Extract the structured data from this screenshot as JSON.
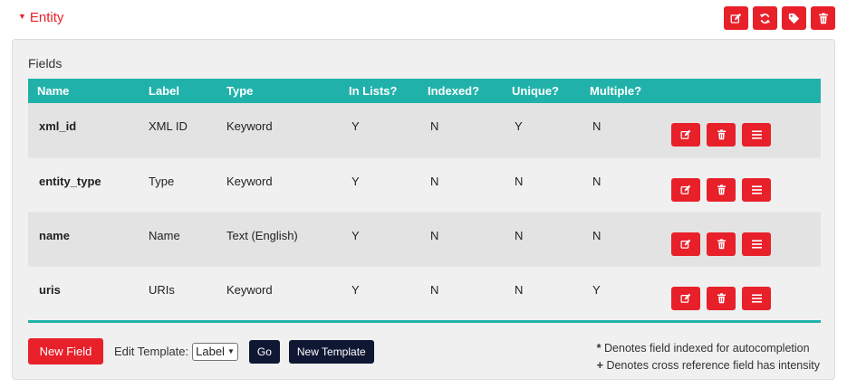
{
  "entity": {
    "title": "Entity",
    "caret": "▼"
  },
  "top_actions": [
    "edit-icon",
    "refresh-icon",
    "tag-icon",
    "trash-icon"
  ],
  "fields": {
    "title": "Fields",
    "headers": [
      "Name",
      "Label",
      "Type",
      "In Lists?",
      "Indexed?",
      "Unique?",
      "Multiple?"
    ],
    "rows": [
      {
        "name": "xml_id",
        "label": "XML ID",
        "type": "Keyword",
        "in_lists": "Y",
        "indexed": "N",
        "unique": "Y",
        "multiple": "N"
      },
      {
        "name": "entity_type",
        "label": "Type",
        "type": "Keyword",
        "in_lists": "Y",
        "indexed": "N",
        "unique": "N",
        "multiple": "N"
      },
      {
        "name": "name",
        "label": "Name",
        "type": "Text (English)",
        "in_lists": "Y",
        "indexed": "N",
        "unique": "N",
        "multiple": "N"
      },
      {
        "name": "uris",
        "label": "URIs",
        "type": "Keyword",
        "in_lists": "Y",
        "indexed": "N",
        "unique": "N",
        "multiple": "Y"
      }
    ]
  },
  "bottom": {
    "new_field": "New Field",
    "edit_template_label": "Edit Template:",
    "template_select_value": "Label",
    "go": "Go",
    "new_template": "New Template"
  },
  "notes": {
    "autocomplete_symbol": "*",
    "autocomplete_text": "Denotes field indexed for autocompletion",
    "crossref_symbol": "+",
    "crossref_text": "Denotes cross reference field has intensity"
  },
  "colors": {
    "accent_red": "#e8202a",
    "teal": "#20b2aa",
    "navy": "#0f1733"
  }
}
